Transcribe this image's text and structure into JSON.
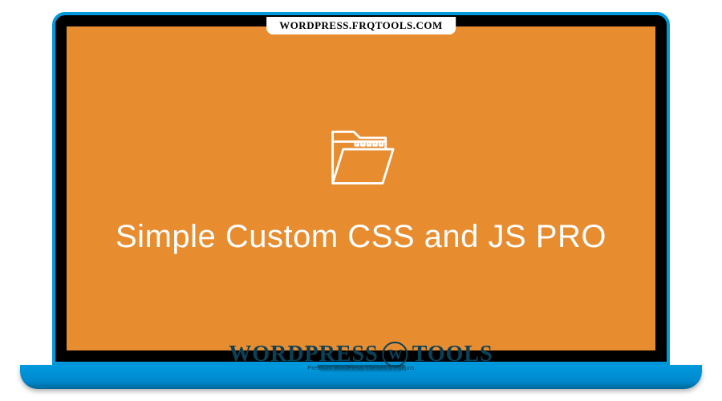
{
  "urlBadge": "WORDPRESS.FRQTOOLS.COM",
  "productTitle": "Simple Custom CSS and JS PRO",
  "watermark": {
    "textLeft": "WORDPRESS",
    "textRight": "TOOLS",
    "tagline": "Premium WordPress Themes & Plugins"
  },
  "colors": {
    "screenBg": "#e78c2f",
    "laptopFrame": "#0099dd",
    "watermarkColor": "#0a4158"
  }
}
